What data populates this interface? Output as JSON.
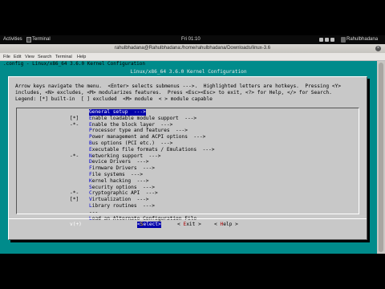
{
  "topbar": {
    "activities": "Activities",
    "app": "Terminal",
    "clock": "Fri 01:10",
    "user": "Rahulbhadana"
  },
  "window": {
    "title": "rahulbhadana@Rahulbhadana:/home/rahulbhadana/Downloads/linux-3.6",
    "close_icon": "close-icon"
  },
  "menubar": [
    "File",
    "Edit",
    "View",
    "Search",
    "Terminal",
    "Help"
  ],
  "terminal": {
    "header_line": ".config - Linux/x86_64 3.6.0 Kernel Configuration",
    "title_line": "Linux/x86_64 3.6.0 Kernel Configuration"
  },
  "dialog": {
    "help_lines": [
      "Arrow keys navigate the menu.  <Enter> selects submenus --->.  Highlighted letters are hotkeys.  Pressing <Y>",
      "includes, <N> excludes, <M> modularizes features.  Press <Esc><Esc> to exit, <?> for Help, </> for Search.",
      "Legend: [*] built-in  [ ] excluded  <M> module  < > module capable"
    ],
    "items": [
      {
        "prefix": "",
        "hot": "G",
        "rest": "eneral setup  --->",
        "selected": true
      },
      {
        "prefix": "[*]",
        "hot": "E",
        "rest": "nable loadable module support  --->",
        "selected": false
      },
      {
        "prefix": "-*-",
        "hot": "E",
        "rest": "nable the block layer  --->",
        "selected": false
      },
      {
        "prefix": "",
        "hot": "P",
        "rest": "rocessor type and features  --->",
        "selected": false
      },
      {
        "prefix": "",
        "hot": "P",
        "rest": "ower management and ACPI options  --->",
        "selected": false
      },
      {
        "prefix": "",
        "hot": "B",
        "rest": "us options (PCI etc.)  --->",
        "selected": false
      },
      {
        "prefix": "",
        "hot": "E",
        "rest": "xecutable file formats / Emulations  --->",
        "selected": false
      },
      {
        "prefix": "-*-",
        "hot": "N",
        "rest": "etworking support  --->",
        "selected": false
      },
      {
        "prefix": "",
        "hot": "D",
        "rest": "evice Drivers  --->",
        "selected": false
      },
      {
        "prefix": "",
        "hot": "F",
        "rest": "irmware Drivers  --->",
        "selected": false
      },
      {
        "prefix": "",
        "hot": "F",
        "rest": "ile systems  --->",
        "selected": false
      },
      {
        "prefix": "",
        "hot": "K",
        "rest": "ernel hacking  --->",
        "selected": false
      },
      {
        "prefix": "",
        "hot": "S",
        "rest": "ecurity options  --->",
        "selected": false
      },
      {
        "prefix": "-*-",
        "hot": "C",
        "rest": "ryptographic API  --->",
        "selected": false
      },
      {
        "prefix": "[*]",
        "hot": "V",
        "rest": "irtualization  --->",
        "selected": false
      },
      {
        "prefix": "",
        "hot": "L",
        "rest": "ibrary routines  --->",
        "selected": false
      },
      {
        "prefix": "",
        "hot": "",
        "rest": "---",
        "selected": false
      },
      {
        "prefix": "",
        "hot": "L",
        "rest": "oad an Alternate Configuration File",
        "selected": false
      }
    ],
    "more_indicator": "v(+)",
    "buttons": [
      {
        "pre": "<",
        "hot": "S",
        "post": "elect>",
        "selected": true
      },
      {
        "pre": "< ",
        "hot": "E",
        "post": "xit >",
        "selected": false
      },
      {
        "pre": "< ",
        "hot": "H",
        "post": "elp >",
        "selected": false
      }
    ]
  }
}
